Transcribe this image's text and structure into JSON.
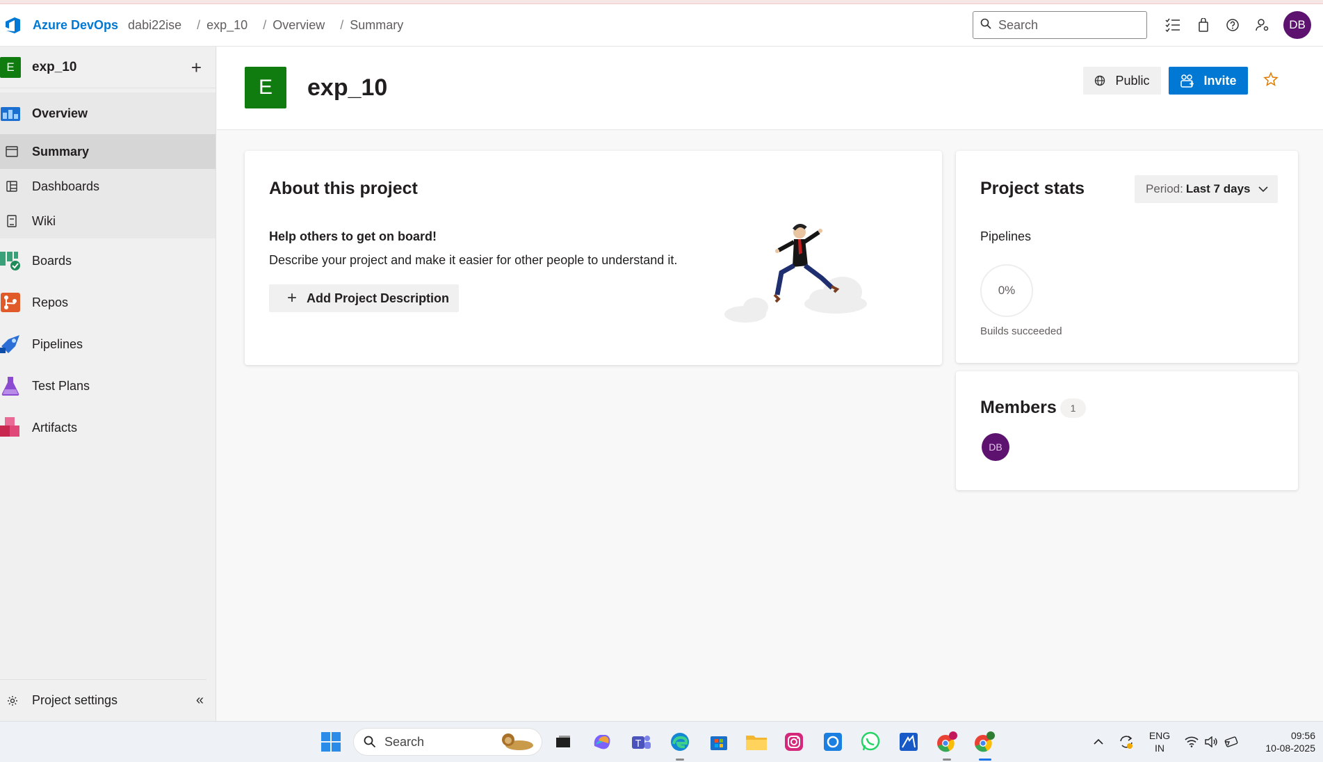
{
  "header": {
    "brand": "Azure DevOps",
    "breadcrumb": [
      "dabi22ise",
      "exp_10",
      "Overview",
      "Summary"
    ],
    "search_placeholder": "Search",
    "user_initials": "DB"
  },
  "sidebar": {
    "project_initial": "E",
    "project_name": "exp_10",
    "items": [
      {
        "label": "Overview",
        "icon": "overview-icon"
      },
      {
        "label": "Summary",
        "icon": "summary-icon"
      },
      {
        "label": "Dashboards",
        "icon": "dashboards-icon"
      },
      {
        "label": "Wiki",
        "icon": "wiki-icon"
      },
      {
        "label": "Boards",
        "icon": "boards-icon"
      },
      {
        "label": "Repos",
        "icon": "repos-icon"
      },
      {
        "label": "Pipelines",
        "icon": "pipelines-icon"
      },
      {
        "label": "Test Plans",
        "icon": "test-plans-icon"
      },
      {
        "label": "Artifacts",
        "icon": "artifacts-icon"
      }
    ],
    "settings_label": "Project settings"
  },
  "page": {
    "project_initial": "E",
    "title": "exp_10",
    "public_label": "Public",
    "invite_label": "Invite"
  },
  "about": {
    "title": "About this project",
    "help_heading": "Help others to get on board!",
    "description": "Describe your project and make it easier for other people to understand it.",
    "add_button": "Add Project Description"
  },
  "stats": {
    "title": "Project stats",
    "period_label": "Period:",
    "period_value": "Last 7 days",
    "pipelines_label": "Pipelines",
    "builds_value": "0%",
    "builds_label": "Builds succeeded"
  },
  "members": {
    "title": "Members",
    "count": "1",
    "avatars": [
      "DB"
    ]
  },
  "taskbar": {
    "search_label": "Search",
    "lang_top": "ENG",
    "lang_bottom": "IN",
    "time": "09:56",
    "date": "10-08-2025"
  },
  "colors": {
    "accent": "#0078d4",
    "project_green": "#107c10",
    "avatar_purple": "#5c126e"
  }
}
